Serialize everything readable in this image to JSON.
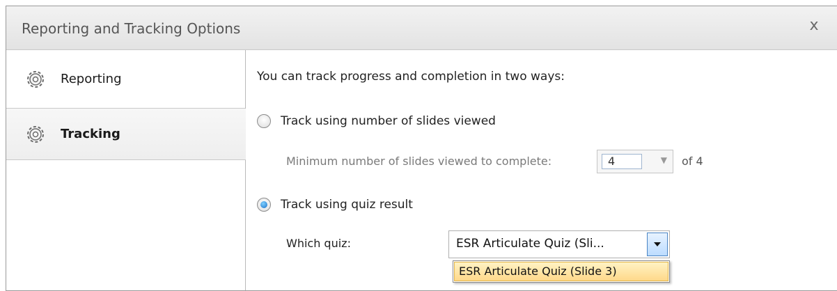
{
  "window": {
    "title": "Reporting and Tracking Options",
    "close_glyph": "x"
  },
  "sidebar": {
    "items": [
      {
        "label": "Reporting",
        "icon": "gear-icon",
        "selected": false
      },
      {
        "label": "Tracking",
        "icon": "gear-icon",
        "selected": true
      }
    ]
  },
  "content": {
    "intro": "You can track progress and completion in two ways:",
    "option_slides": {
      "label": "Track using number of slides viewed",
      "checked": false,
      "minimum_label": "Minimum number of slides viewed to complete:",
      "minimum_value": "4",
      "of_text": "of 4"
    },
    "option_quiz": {
      "label": "Track using quiz result",
      "checked": true,
      "which_label": "Which quiz:",
      "selected_value": "ESR Articulate Quiz (Sli...",
      "dropdown_options": [
        "ESR Articulate Quiz (Slide 3)"
      ]
    }
  },
  "colors": {
    "selected_radio": "#1a70c8",
    "dropdown_highlight": "#ffd98a",
    "sidebar_selected_bg": "#eeeeee"
  }
}
